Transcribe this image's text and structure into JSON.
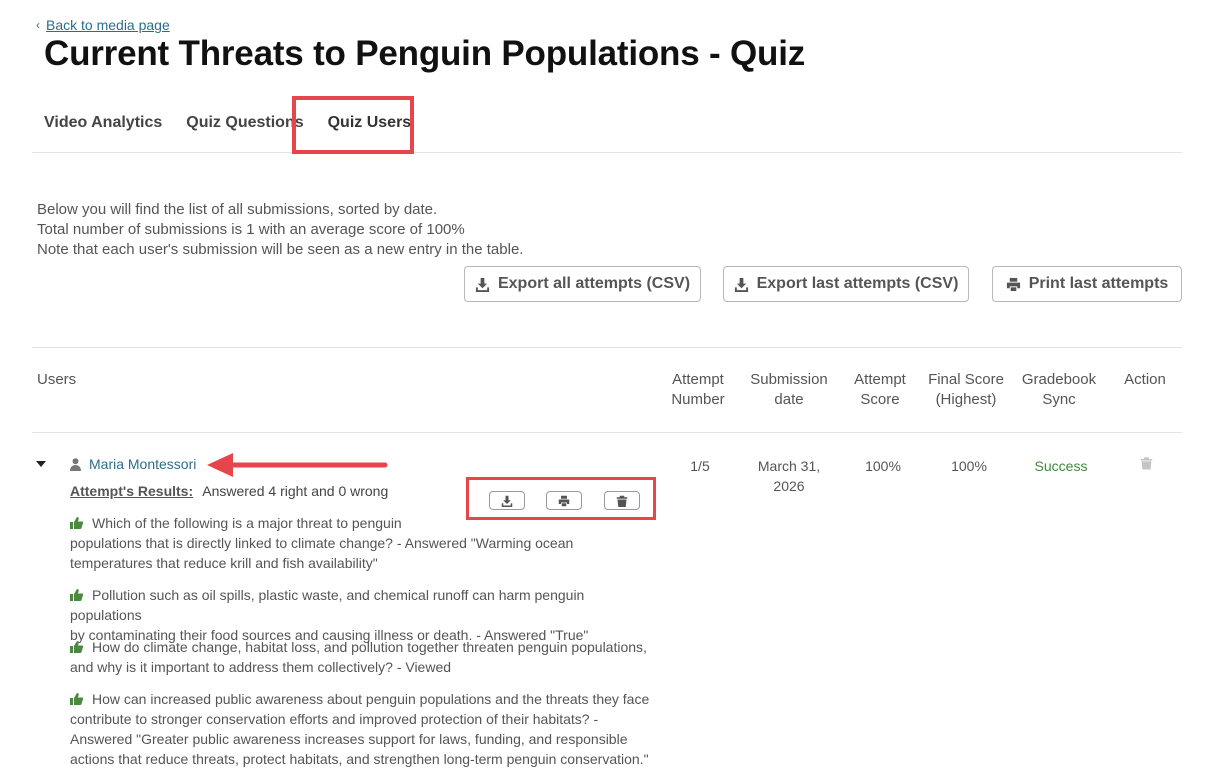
{
  "back_link": "Back to media page",
  "title": "Current Threats to Penguin Populations - Quiz",
  "tabs": [
    {
      "label": "Video Analytics"
    },
    {
      "label": "Quiz Questions"
    },
    {
      "label": "Quiz Users"
    }
  ],
  "intro": {
    "line1": "Below you will find the list of all submissions, sorted by date.",
    "line2": "Total number of submissions is 1 with an average score of 100%",
    "line3": "Note that each user's submission will be seen as a new entry in the table."
  },
  "buttons": {
    "export_all": "Export all attempts (CSV)",
    "export_last": "Export last attempts (CSV)",
    "print_last": "Print last attempts"
  },
  "table": {
    "headers": {
      "users": "Users",
      "attempt_number": [
        "Attempt",
        "Number"
      ],
      "submission_date": [
        "Submission",
        "date"
      ],
      "attempt_score": [
        "Attempt",
        "Score"
      ],
      "final_score": [
        "Final Score",
        "(Highest)"
      ],
      "gradebook_sync": [
        "Gradebook",
        "Sync"
      ],
      "action": "Action"
    },
    "row": {
      "user_name": "Maria Montessori",
      "attempt": "1/5",
      "date_line1": "March 31,",
      "date_line2": "2026",
      "attempt_score": "100%",
      "final_score": "100%",
      "gradebook_sync": "Success",
      "results_label": "Attempt's Results:",
      "results_text": "Answered 4 right and 0 wrong",
      "questions": [
        {
          "line1": "Which of the following is a major threat to penguin",
          "line2": "populations that is directly linked to climate change? - Answered \"Warming ocean",
          "line3": "temperatures that reduce krill and fish availability\"",
          "line4": ""
        },
        {
          "line1": "Pollution such as oil spills, plastic waste, and chemical runoff can harm penguin populations",
          "line2": "by contaminating their food sources and causing illness or death. - Answered \"True\"",
          "line3": "",
          "line4": ""
        },
        {
          "line1": "How do climate change, habitat loss, and pollution together threaten penguin populations,",
          "line2": "and why is it important to address them collectively? - Viewed",
          "line3": "",
          "line4": ""
        },
        {
          "line1": "How can increased public awareness about penguin populations and the threats they face",
          "line2": "contribute to stronger conservation efforts and improved protection of their habitats? -",
          "line3": "Answered \"Greater public awareness increases support for laws, funding, and responsible",
          "line4": "actions that reduce threats, protect habitats, and strengthen long-term penguin conservation.\""
        }
      ]
    }
  },
  "icons": {
    "download": "download-icon",
    "print": "print-icon",
    "trash": "trash-icon",
    "user": "user-icon",
    "thumb": "thumbs-up-icon"
  },
  "colors": {
    "link": "#2a6f8a",
    "highlight": "#e5454b",
    "success": "#3d8a3a"
  }
}
